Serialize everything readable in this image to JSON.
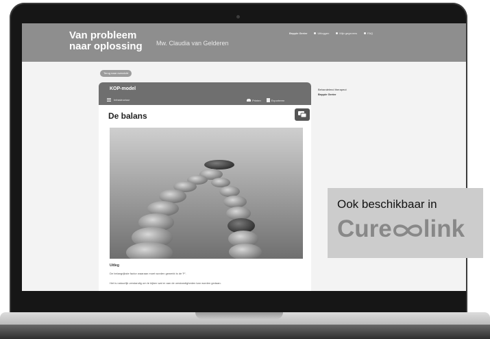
{
  "header": {
    "title": "Van probleem naar oplossing",
    "client_name": "Mw. Claudia van Gelderen",
    "user": "Beppie Gerter",
    "nav": [
      "Uitloggen",
      "Mijn gegevens",
      "FAQ"
    ]
  },
  "back_button": "Terug naar overzicht",
  "card": {
    "title": "KOP-model",
    "subtitle": "Infrastructuur",
    "actions": [
      "Printen",
      "Exporteren"
    ],
    "lesson_title": "De balans",
    "section": "Uitleg",
    "paragraphs": [
      "De belangrijkste factor waaraan moet worden gewerkt is de 'P'.",
      "Het is natuurlijk verstandig om te kijken wat er aan de omstandigheden kan worden gedaan."
    ]
  },
  "therapist": {
    "label": "Behandelend therapeut",
    "name": "Beppie Gerter"
  },
  "promo": {
    "line": "Ook beschikbaar in",
    "brand_left": "Cure",
    "brand_right": "link"
  },
  "icons": {
    "list": "list-icon",
    "print": "printer-icon",
    "export": "export-icon",
    "chat": "chat-icon",
    "logo": "infinity-icon"
  },
  "colors": {
    "header": "#8e8e8e",
    "card_header": "#6f6f6f",
    "promo_bg": "#cccccc",
    "brand": "#888888"
  }
}
